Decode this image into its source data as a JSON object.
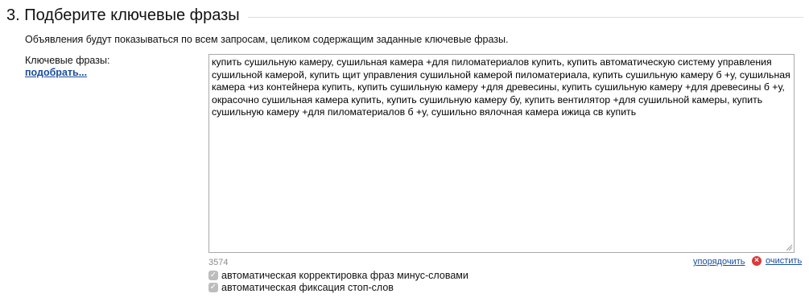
{
  "section": {
    "title": "3. Подберите ключевые фразы",
    "description": "Объявления будут показываться по всем запросам, целиком содержащим заданные ключевые фразы."
  },
  "keywords": {
    "label": "Ключевые фразы:",
    "pick_link": "подобрать...",
    "text": "купить сушильную камеру, сушильная камера +для пиломатериалов купить, купить автоматическую систему управления сушильной камерой, купить щит управления сушильной камерой пиломатериала, купить сушильную камеру б +у, сушильная камера +из контейнера купить, купить сушильную камеру +для древесины, купить сушильную камеру +для древесины б +у, окрасочно сушильная камера купить, купить сушильную камеру бу, купить вентилятор +для сушильной камеры, купить сушильную камеру +для пиломатериалов б +у, сушильно вялочная камера ижица св купить",
    "counter": "3574",
    "sort_link": "упорядочить",
    "clear_link": "очистить",
    "clear_icon": "close-circle-icon"
  },
  "options": [
    {
      "label": "автоматическая корректировка фраз минус-словами",
      "checked": true
    },
    {
      "label": "автоматическая фиксация стоп-слов",
      "checked": true
    }
  ],
  "colors": {
    "link": "#1a4fa0",
    "clear_icon": "#d93a3a",
    "checkbox": "#bdbdbd",
    "counter": "#8a8a8a"
  }
}
